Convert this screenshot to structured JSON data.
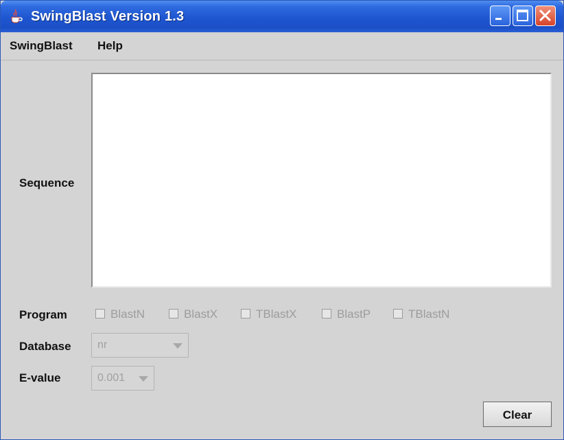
{
  "window": {
    "title": "SwingBlast Version 1.3"
  },
  "icons": {
    "app": "java-cup-icon",
    "minimize": "minimize-icon",
    "maximize": "maximize-icon",
    "close": "close-icon"
  },
  "menu": {
    "items": [
      "SwingBlast",
      "Help"
    ]
  },
  "form": {
    "sequence_label": "Sequence",
    "sequence_value": "",
    "program_label": "Program",
    "programs": [
      "BlastN",
      "BlastX",
      "TBlastX",
      "BlastP",
      "TBlastN"
    ],
    "database_label": "Database",
    "database_value": "nr",
    "evalue_label": "E-value",
    "evalue_value": "0.001",
    "clear_label": "Clear"
  },
  "colors": {
    "titlebar": "#1e56d0",
    "background": "#d4d4d4",
    "close_button": "#d6442a",
    "disabled_text": "#9c9c9c"
  }
}
